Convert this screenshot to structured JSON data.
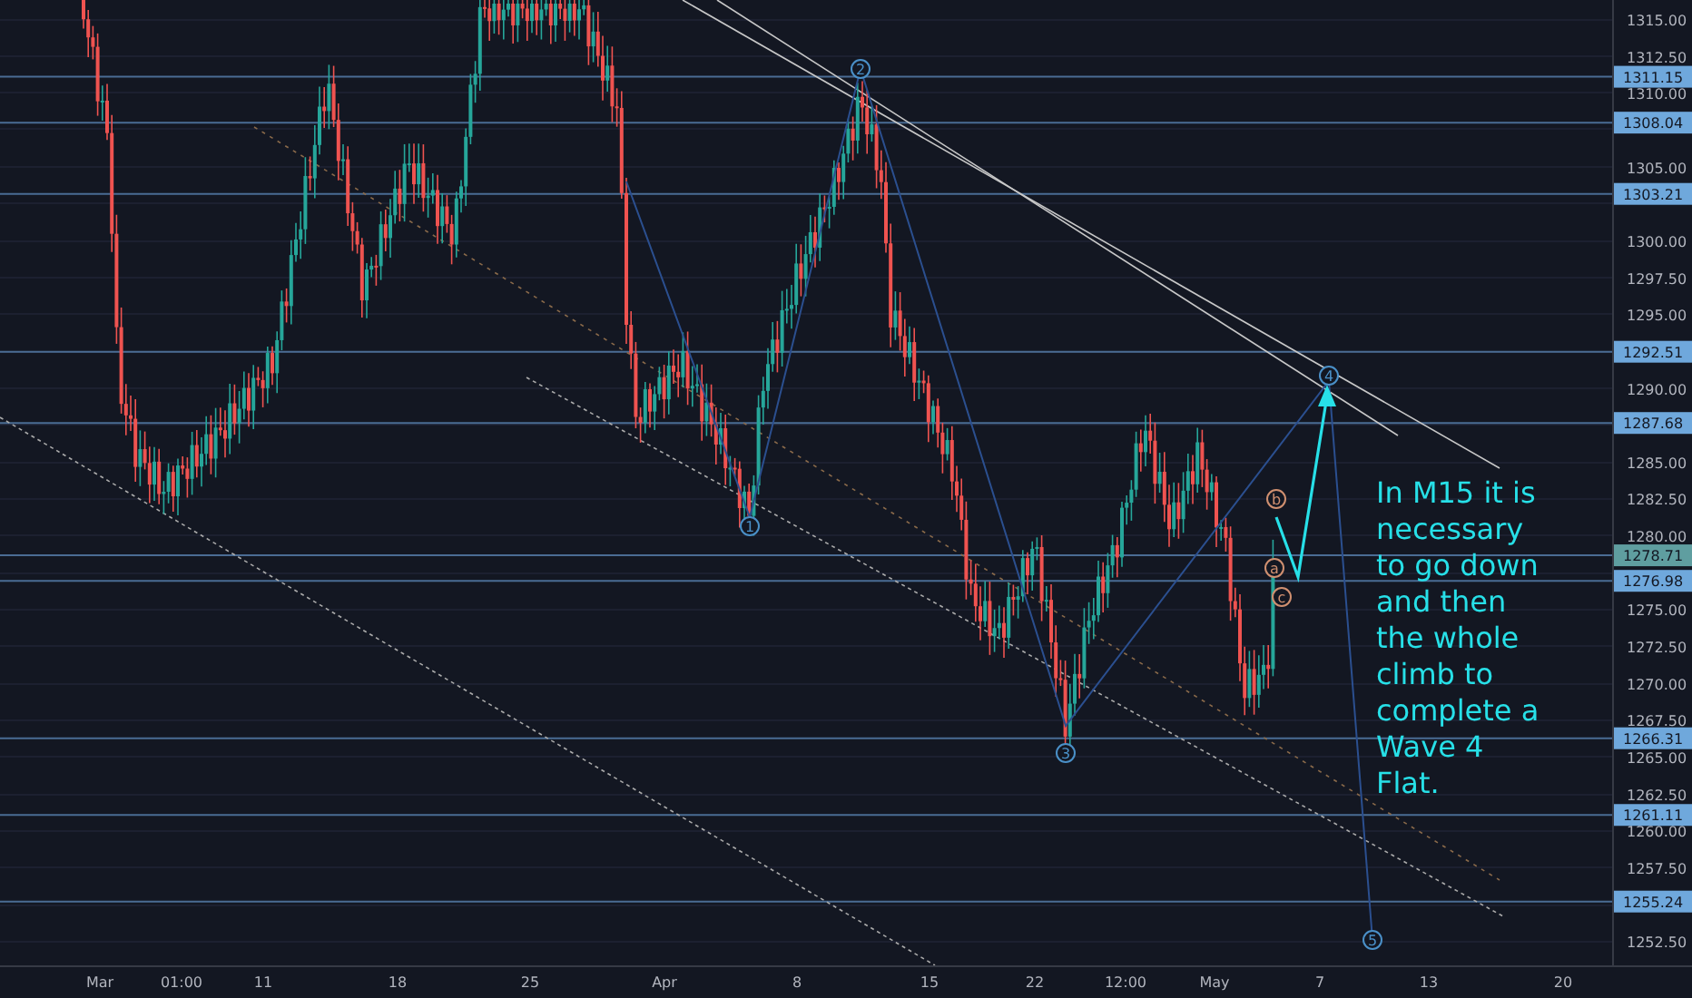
{
  "price_axis": {
    "ticks": [
      "1315.00",
      "1312.50",
      "1310.00",
      "1305.00",
      "1300.00",
      "1297.50",
      "1295.00",
      "1290.00",
      "1285.00",
      "1282.50",
      "1280.00",
      "1275.00",
      "1272.50",
      "1270.00",
      "1267.50",
      "1265.00",
      "1262.50",
      "1260.00",
      "1257.50",
      "1252.50"
    ],
    "markers": [
      {
        "value": "1311.15",
        "color": "#6fa8dc"
      },
      {
        "value": "1308.04",
        "color": "#6fa8dc"
      },
      {
        "value": "1303.21",
        "color": "#6fa8dc"
      },
      {
        "value": "1292.51",
        "color": "#6fa8dc"
      },
      {
        "value": "1287.68",
        "color": "#6fa8dc"
      },
      {
        "value": "1278.71",
        "color": "#5f9ea0"
      },
      {
        "value": "1276.98",
        "color": "#6fa8dc"
      },
      {
        "value": "1266.31",
        "color": "#6fa8dc"
      },
      {
        "value": "1261.11",
        "color": "#6fa8dc"
      },
      {
        "value": "1255.24",
        "color": "#6fa8dc"
      }
    ]
  },
  "time_axis": [
    "Mar",
    "01:00",
    "11",
    "18",
    "25",
    "Apr",
    "8",
    "15",
    "22",
    "12:00",
    "May",
    "7",
    "13",
    "20"
  ],
  "wave_labels": [
    {
      "text": "1",
      "kind": "impulse"
    },
    {
      "text": "2",
      "kind": "impulse"
    },
    {
      "text": "3",
      "kind": "impulse"
    },
    {
      "text": "4",
      "kind": "impulse"
    },
    {
      "text": "5",
      "kind": "impulse"
    },
    {
      "text": "b",
      "kind": "corrective"
    },
    {
      "text": "a",
      "kind": "corrective"
    },
    {
      "text": "c",
      "kind": "corrective"
    }
  ],
  "annotation": [
    "In M15 it is",
    "necessary",
    "to go down",
    "and then",
    "the whole",
    "climb to",
    "complete a",
    "Wave 4",
    "Flat."
  ]
}
